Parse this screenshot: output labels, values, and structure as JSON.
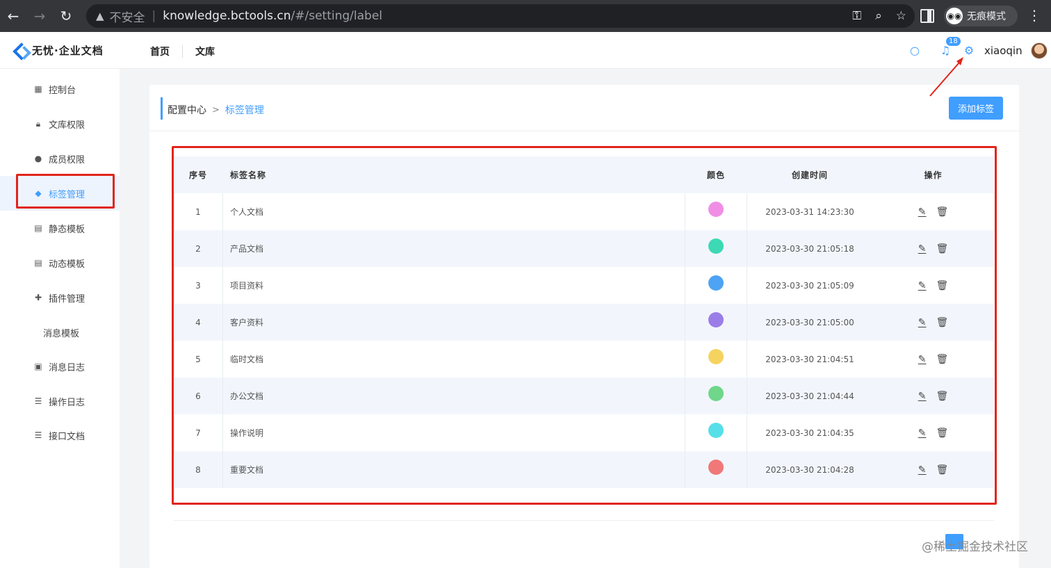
{
  "browser": {
    "warning_text": "不安全",
    "url_host": "knowledge.bctools.cn",
    "url_path": "/#/setting/label",
    "incognito_label": "无痕模式"
  },
  "header": {
    "logo_text": "无忧·企业文档",
    "nav": [
      "首页",
      "文库"
    ],
    "notification_count": "18",
    "username": "xiaoqin"
  },
  "sidebar": {
    "items": [
      {
        "label": "控制台",
        "icon": "dashboard-icon"
      },
      {
        "label": "文库权限",
        "icon": "lock-icon"
      },
      {
        "label": "成员权限",
        "icon": "user-icon"
      },
      {
        "label": "标签管理",
        "icon": "tag-icon",
        "active": true
      },
      {
        "label": "静态模板",
        "icon": "template-icon"
      },
      {
        "label": "动态模板",
        "icon": "template-icon"
      },
      {
        "label": "插件管理",
        "icon": "puzzle-icon"
      },
      {
        "label": "消息模板",
        "icon": ""
      },
      {
        "label": "消息日志",
        "icon": "clipboard-icon"
      },
      {
        "label": "操作日志",
        "icon": "list-icon"
      },
      {
        "label": "接口文档",
        "icon": "list-icon"
      }
    ]
  },
  "breadcrumb": {
    "parent": "配置中心",
    "separator": ">",
    "current": "标签管理"
  },
  "add_button_label": "添加标签",
  "table": {
    "headers": {
      "index": "序号",
      "name": "标签名称",
      "color": "颜色",
      "created": "创建时间",
      "ops": "操作"
    },
    "rows": [
      {
        "index": "1",
        "name": "个人文档",
        "color": "#f08ee6",
        "created": "2023-03-31 14:23:30"
      },
      {
        "index": "2",
        "name": "产品文档",
        "color": "#3dd9b5",
        "created": "2023-03-30 21:05:18"
      },
      {
        "index": "3",
        "name": "项目资料",
        "color": "#4ea3f5",
        "created": "2023-03-30 21:05:09"
      },
      {
        "index": "4",
        "name": "客户资料",
        "color": "#9b7de8",
        "created": "2023-03-30 21:05:00"
      },
      {
        "index": "5",
        "name": "临时文档",
        "color": "#f5d35f",
        "created": "2023-03-30 21:04:51"
      },
      {
        "index": "6",
        "name": "办公文档",
        "color": "#6fd68a",
        "created": "2023-03-30 21:04:44"
      },
      {
        "index": "7",
        "name": "操作说明",
        "color": "#56dfe8",
        "created": "2023-03-30 21:04:35"
      },
      {
        "index": "8",
        "name": "重要文档",
        "color": "#f07878",
        "created": "2023-03-30 21:04:28"
      }
    ]
  },
  "watermark": "@稀土掘金技术社区",
  "colors": {
    "accent": "#409eff",
    "highlight_box": "#e1251b"
  }
}
